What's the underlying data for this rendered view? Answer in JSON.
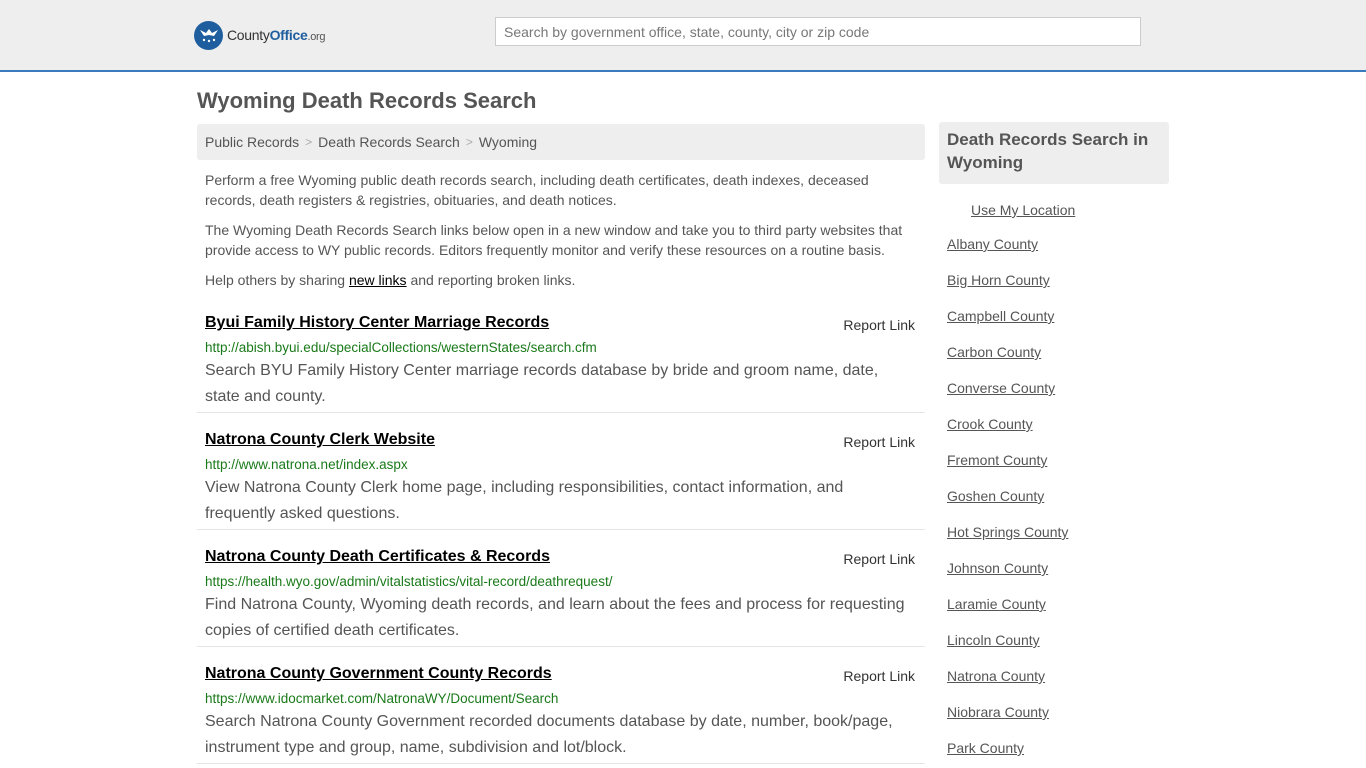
{
  "header": {
    "logo": {
      "brand_a": "County",
      "brand_b": "Office",
      "tld": ".org"
    },
    "search": {
      "placeholder": "Search by government office, state, county, city or zip code"
    }
  },
  "page": {
    "title": "Wyoming Death Records Search"
  },
  "breadcrumb": [
    "Public Records",
    "Death Records Search",
    "Wyoming"
  ],
  "intro": {
    "p1": "Perform a free Wyoming public death records search, including death certificates, death indexes, deceased records, death registers & registries, obituaries, and death notices.",
    "p2": "The Wyoming Death Records Search links below open in a new window and take you to third party websites that provide access to WY public records. Editors frequently monitor and verify these resources on a routine basis.",
    "p3_before": "Help others by sharing ",
    "p3_link": "new links",
    "p3_after": " and reporting broken links."
  },
  "results": [
    {
      "title": "Byui Family History Center Marriage Records",
      "report": "Report Link",
      "url": "http://abish.byui.edu/specialCollections/westernStates/search.cfm",
      "desc": "Search BYU Family History Center marriage records database by bride and groom name, date, state and county."
    },
    {
      "title": "Natrona County Clerk Website",
      "report": "Report Link",
      "url": "http://www.natrona.net/index.aspx",
      "desc": "View Natrona County Clerk home page, including responsibilities, contact information, and frequently asked questions."
    },
    {
      "title": "Natrona County Death Certificates & Records",
      "report": "Report Link",
      "url": "https://health.wyo.gov/admin/vitalstatistics/vital-record/deathrequest/",
      "desc": "Find Natrona County, Wyoming death records, and learn about the fees and process for requesting copies of certified death certificates."
    },
    {
      "title": "Natrona County Government County Records",
      "report": "Report Link",
      "url": "https://www.idocmarket.com/NatronaWY/Document/Search",
      "desc": "Search Natrona County Government recorded documents database by date, number, book/page, instrument type and group, name, subdivision and lot/block."
    }
  ],
  "sidebar": {
    "title": "Death Records Search in Wyoming",
    "use_location": "Use My Location",
    "counties": [
      "Albany County",
      "Big Horn County",
      "Campbell County",
      "Carbon County",
      "Converse County",
      "Crook County",
      "Fremont County",
      "Goshen County",
      "Hot Springs County",
      "Johnson County",
      "Laramie County",
      "Lincoln County",
      "Natrona County",
      "Niobrara County",
      "Park County"
    ]
  },
  "colors": {
    "accent": "#3a7bbf",
    "link_url": "#1a7a1a",
    "panel": "#eeeeee"
  }
}
